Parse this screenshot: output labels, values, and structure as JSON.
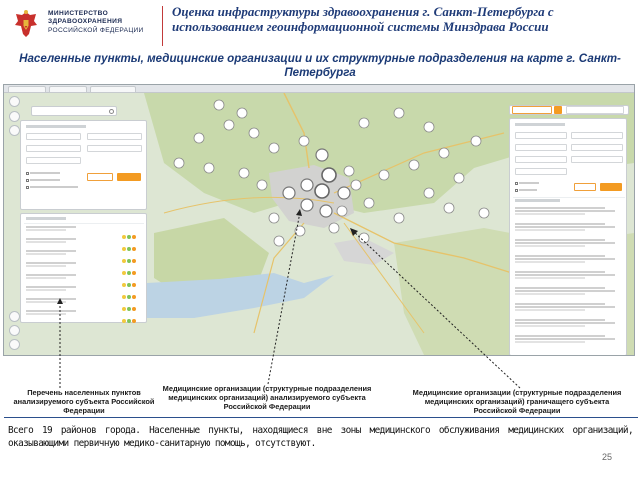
{
  "header": {
    "emblem_icon": "russian-coat-of-arms-icon",
    "ministry_lines": [
      "МИНИСТЕРСТВО",
      "ЗДРАВООХРАНЕНИЯ",
      "РОССИЙСКОЙ ФЕДЕРАЦИИ"
    ],
    "title": "Оценка инфраструктуры здравоохранения г. Санкт-Петербурга с использованием геоинформационной системы Минздрава России",
    "subtitle": "Населенные пункты, медицинские организации и их структурные подразделения на карте г. Санкт-Петербурга",
    "colors": {
      "title": "#1f3b78",
      "accent_rule": "#c23a3a"
    }
  },
  "app_screenshot": {
    "map_icon_names": [
      "layers-icon",
      "zoom-in-icon",
      "zoom-out-icon",
      "ruler-icon",
      "pencil-icon",
      "print-icon"
    ],
    "map_cluster_color": "#ffffff",
    "water_color": "#bcd3e4",
    "forest_color": "#c7d9a8"
  },
  "captions": {
    "settlements": "Перечень населенных пунктов анализируемого субъекта Российской Федерации",
    "med_orgs_subject": "Медицинские организации (структурные подразделения медицинских организаций) анализируемого субъекта Российской Федерации",
    "med_orgs_neighbor": "Медицинские организации (структурные подразделения медицинских организаций) граничащего субъекта Российской Федерации"
  },
  "summary": "Всего 19 районов города. Населенные пункты, находящиеся вне зоны медицинского обслуживания медицинских организаций, оказывающими первичную медико-санитарную помощь, отсутствуют.",
  "page_number": "25",
  "colors": {
    "button_orange": "#f39b22",
    "summary_rule": "#2b4f8c"
  }
}
